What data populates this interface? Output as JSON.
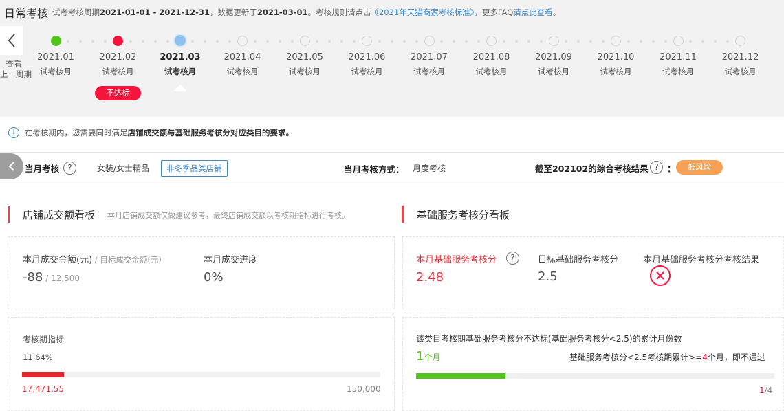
{
  "header": {
    "title": "日常考核",
    "info_prefix": "试考考核周期",
    "period": "2021-01-01 - 2021-12-31",
    "info_mid": "，数据更新于",
    "update_date": "2021-03-01",
    "info_mid2": "。考核规则请点击",
    "rule_link": "《2021年天猫商家考核标准》",
    "info_mid3": "，更多FAQ",
    "faq_link": "请点此查看",
    "info_end": "。",
    "prev_label_line1": "查看",
    "prev_label_line2": "上一周期"
  },
  "timeline": {
    "months": [
      {
        "month": "2021.01",
        "label": "试考核月",
        "status": "pass"
      },
      {
        "month": "2021.02",
        "label": "试考核月",
        "status": "fail"
      },
      {
        "month": "2021.03",
        "label": "试考核月",
        "status": "current"
      },
      {
        "month": "2021.04",
        "label": "试考核月",
        "status": "future"
      },
      {
        "month": "2021.05",
        "label": "试考核月",
        "status": "future"
      },
      {
        "month": "2021.06",
        "label": "试考核月",
        "status": "future"
      },
      {
        "month": "2021.07",
        "label": "试考核月",
        "status": "future"
      },
      {
        "month": "2021.08",
        "label": "试考核月",
        "status": "future"
      },
      {
        "month": "2021.09",
        "label": "试考核月",
        "status": "future"
      },
      {
        "month": "2021.10",
        "label": "试考核月",
        "status": "future"
      },
      {
        "month": "2021.11",
        "label": "试考核月",
        "status": "future"
      },
      {
        "month": "2021.12",
        "label": "试考核月",
        "status": "future"
      }
    ],
    "fail_badge": "不达标"
  },
  "notice": {
    "prefix": "在考核期内，您需要同时满足",
    "bold": "店铺成交额与基础服务考核分对应类目的要求。"
  },
  "summary": {
    "month_label": "当月考核",
    "category": "女装/女士精品",
    "store_type": "非冬季品类店铺",
    "method_label": "当月考核方式：",
    "method_value": "月度考核",
    "result_label": "截至202102的综合考核结果",
    "colon": "：",
    "risk": "低风险"
  },
  "left_section": {
    "title": "店铺成交额看板",
    "note": "本月店铺成交额仅做建议参考，最终店铺成交额以考核期指标进行考核。",
    "gmv_label": "本月成交金额(元)",
    "gmv_sep": " / ",
    "target_label": "目标成交金额(元)",
    "gmv_value": "-88",
    "slash": " / ",
    "target_value": "12,500",
    "progress_label": "本月成交进度",
    "progress_value": "0%",
    "period_label": "考核期指标",
    "period_percent_text": "11.64%",
    "period_progress": 0.1164,
    "period_current": "17,471.55",
    "period_target": "150,000"
  },
  "right_section": {
    "title": "基础服务考核分看板",
    "score_label": "本月基础服务考核分",
    "score_value": "2.48",
    "target_label": "目标基础服务考核分",
    "target_value": "2.5",
    "result_label": "本月基础服务考核分考核结果",
    "fail_title": "该类目考核期基础服务考核分不达标(基础服务考核分<2.5)的累计月份数",
    "months_count": "1",
    "months_unit": "个月",
    "rule_prefix": "基础服务考核分<2.5考核期累计>=",
    "rule_count": "4",
    "rule_suffix": "个月，即不通过",
    "fail_progress": 0.25,
    "pager_current": "1",
    "pager_total": "/4"
  },
  "colors": {
    "red": "#f5143c",
    "green": "#52c41a",
    "blue": "#3a87c8",
    "orange": "#f6a154",
    "bar_red": "#e0282e",
    "bar_green": "#52c41a"
  }
}
